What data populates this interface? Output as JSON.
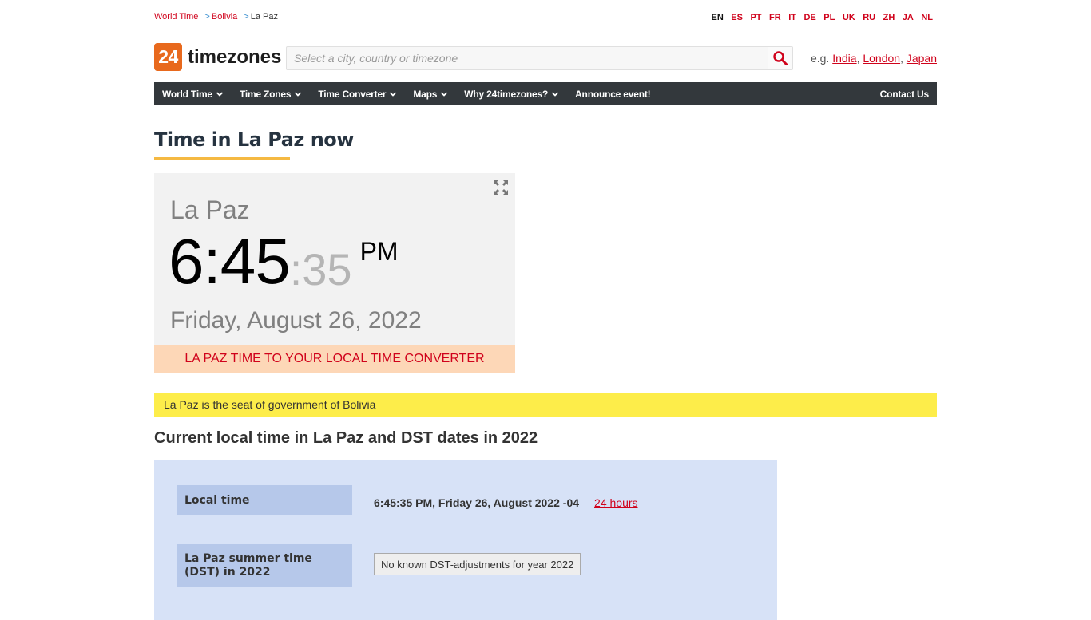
{
  "breadcrumb": [
    {
      "label": "World Time",
      "link": true
    },
    {
      "label": "Bolivia",
      "link": true
    },
    {
      "label": "La Paz",
      "link": false
    }
  ],
  "languages": [
    {
      "code": "EN",
      "active": true
    },
    {
      "code": "ES",
      "active": false
    },
    {
      "code": "PT",
      "active": false
    },
    {
      "code": "FR",
      "active": false
    },
    {
      "code": "IT",
      "active": false
    },
    {
      "code": "DE",
      "active": false
    },
    {
      "code": "PL",
      "active": false
    },
    {
      "code": "UK",
      "active": false
    },
    {
      "code": "RU",
      "active": false
    },
    {
      "code": "ZH",
      "active": false
    },
    {
      "code": "JA",
      "active": false
    },
    {
      "code": "NL",
      "active": false
    }
  ],
  "logo": {
    "number": "24",
    "text": "timezones",
    "brand_color": "#e8691d"
  },
  "search": {
    "placeholder": "Select a city, country or timezone",
    "value": "",
    "icon": "search-icon"
  },
  "examples": {
    "prefix": "e.g.",
    "links": [
      "India",
      "London",
      "Japan"
    ]
  },
  "nav": {
    "items": [
      {
        "label": "World Time",
        "dropdown": true
      },
      {
        "label": "Time Zones",
        "dropdown": true
      },
      {
        "label": "Time Converter",
        "dropdown": true
      },
      {
        "label": "Maps",
        "dropdown": true
      },
      {
        "label": "Why 24timezones?",
        "dropdown": true
      },
      {
        "label": "Announce event!",
        "dropdown": false
      }
    ],
    "contact": "Contact Us"
  },
  "page": {
    "title": "Time in La Paz now"
  },
  "clock": {
    "city": "La Paz",
    "hours_minutes": "6:45",
    "seconds": ":35",
    "ampm": "PM",
    "date": "Friday, August 26, 2022",
    "converter_label": "LA PAZ TIME TO YOUR LOCAL TIME CONVERTER",
    "expand_icon": "fullscreen-icon"
  },
  "banner": {
    "text": "La Paz is the seat of government of Bolivia"
  },
  "dst": {
    "title": "Current local time in La Paz and DST dates in 2022",
    "rows": [
      {
        "label": "Local time",
        "value": "6:45:35 PM, Friday 26, August 2022 -04",
        "link": "24 hours"
      },
      {
        "label": "La Paz summer time (DST) in 2022",
        "value": "No known DST-adjustments for year 2022"
      }
    ]
  },
  "colors": {
    "accent_red": "#d0021b",
    "nav_bg": "#33383c",
    "title_underline": "#f5b942",
    "banner_bg": "#fded4a",
    "converter_bg": "#fdd7b7",
    "panel_bg": "#d7e2f7",
    "label_bg": "#b6c8ea"
  }
}
